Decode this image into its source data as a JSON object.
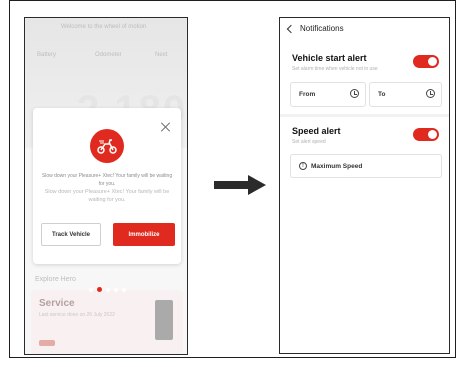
{
  "left_phone": {
    "background": {
      "top_text": "Welcome to the wheel of motion",
      "labels": [
        "Battery",
        "Odometer",
        "Next"
      ],
      "big_numbers": "2,180",
      "explore_label": "Explore Hero",
      "card_title": "Service",
      "card_subtitle": "Last service done on 26 July 2022"
    },
    "modal": {
      "message_primary": "Slow down your Pleasure+ Xtec! Your family will be waiting for you.",
      "message_ghost": "Slow down your Pleasure+ Xtec! Your family will be waiting for you.",
      "track_button": "Track Vehicle",
      "immobilize_button": "Immobilize",
      "icon": "scooter-icon"
    },
    "carousel": {
      "count": 5,
      "active_index": 1
    }
  },
  "right_phone": {
    "nav_title": "Notifications",
    "vehicle_start": {
      "title": "Vehicle start alert",
      "subtitle": "Set alarm time when vehicle not in use",
      "from_label": "From",
      "to_label": "To",
      "enabled": true
    },
    "speed_alert": {
      "title": "Speed alert",
      "subtitle": "Set alert speed",
      "max_speed_label": "Maximum Speed",
      "enabled": true
    }
  },
  "colors": {
    "accent": "#e02a1f",
    "border": "#1f1f1f"
  }
}
